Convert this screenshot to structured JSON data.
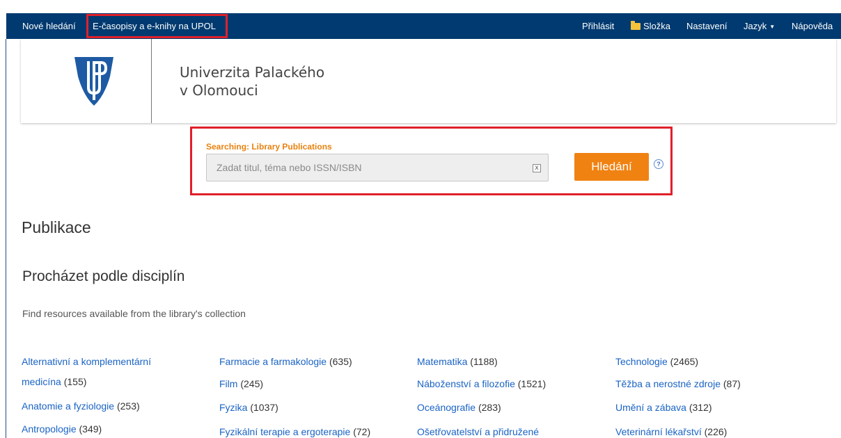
{
  "nav": {
    "left": [
      "Nové hledání",
      "E-časopisy a e-knihy na UPOL"
    ],
    "right": [
      "Přihlásit",
      "Složka",
      "Nastavení",
      "Jazyk",
      "Nápověda"
    ]
  },
  "header": {
    "uni_line1": "Univerzita Palackého",
    "uni_line2": "v Olomouci"
  },
  "search": {
    "label": "Searching: Library Publications",
    "placeholder": "Zadat titul, téma nebo ISSN/ISBN",
    "clear": "x",
    "button": "Hledání",
    "help": "?"
  },
  "page": {
    "title": "Publikace",
    "browse_heading": "Procházet podle disciplín",
    "find_text": "Find resources available from the library's collection"
  },
  "disciplines": {
    "col1": [
      {
        "name": "Alternativní a komplementární",
        "count": ""
      },
      {
        "name": "medicína",
        "count": "(155)"
      },
      {
        "name": "Anatomie a fyziologie",
        "count": "(253)"
      },
      {
        "name": "Antropologie",
        "count": "(349)"
      }
    ],
    "col2": [
      {
        "name": "Farmacie a farmakologie",
        "count": "(635)"
      },
      {
        "name": "Film",
        "count": "(245)"
      },
      {
        "name": "Fyzika",
        "count": "(1037)"
      },
      {
        "name": "Fyzikální terapie a ergoterapie",
        "count": "(72)"
      }
    ],
    "col3": [
      {
        "name": "Matematika",
        "count": "(1188)"
      },
      {
        "name": "Náboženství a filozofie",
        "count": "(1521)"
      },
      {
        "name": "Oceánografie",
        "count": "(283)"
      },
      {
        "name": "Ošetřovatelství a přidružené",
        "count": ""
      }
    ],
    "col4": [
      {
        "name": "Technologie",
        "count": "(2465)"
      },
      {
        "name": "Těžba a nerostné zdroje",
        "count": "(87)"
      },
      {
        "name": "Umění a zábava",
        "count": "(312)"
      },
      {
        "name": "Veterinární lékařství",
        "count": "(226)"
      }
    ]
  }
}
